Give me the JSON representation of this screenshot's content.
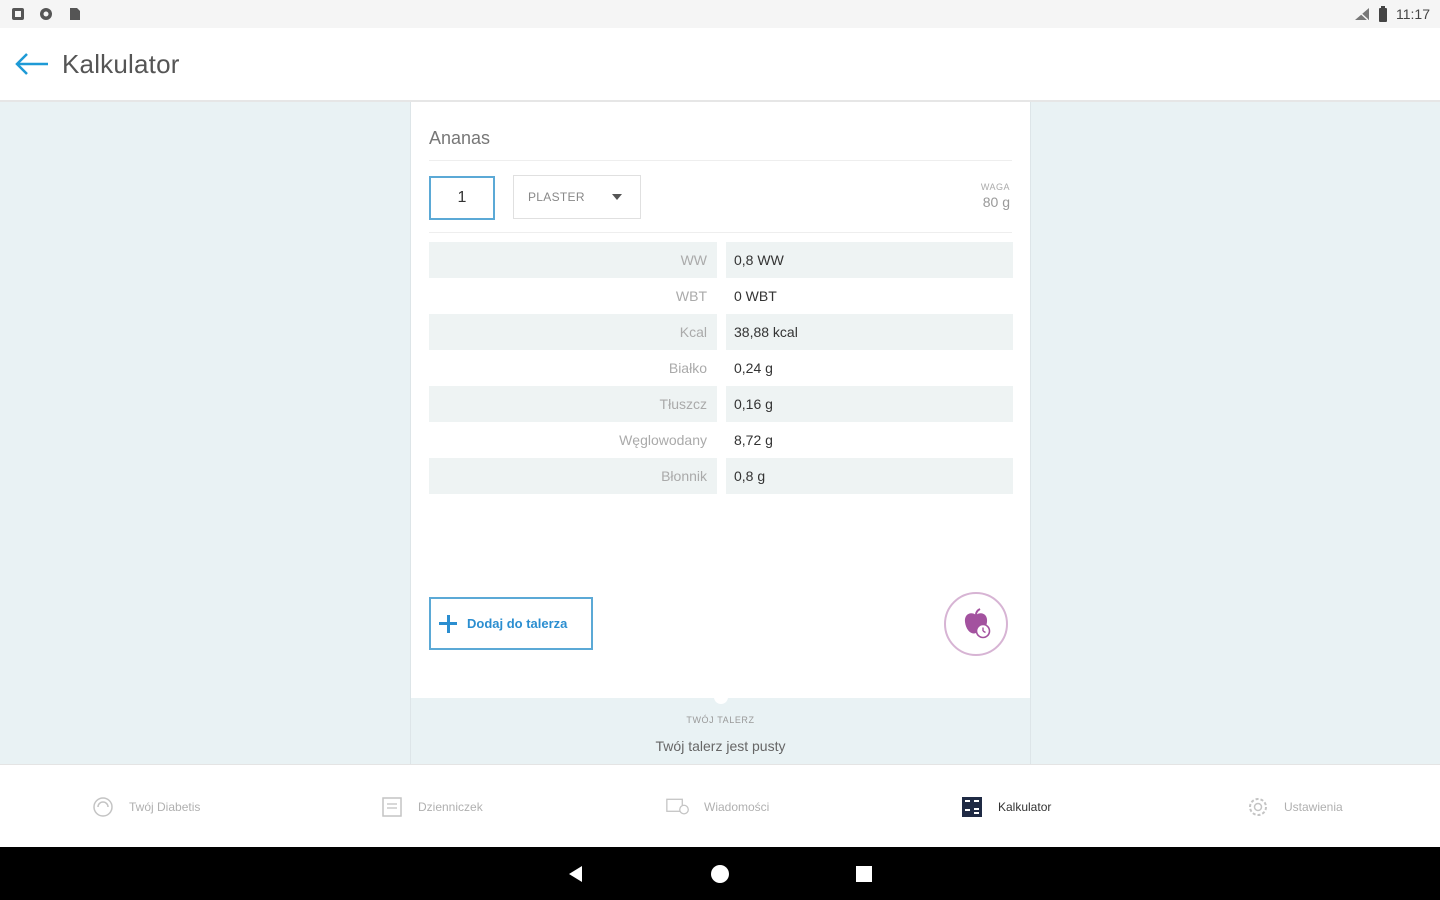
{
  "status_bar": {
    "time": "11:17"
  },
  "app_bar": {
    "title": "Kalkulator"
  },
  "product": {
    "name": "Ananas",
    "quantity": "1",
    "unit": "PLASTER",
    "weight_caption": "WAGA",
    "weight_value": "80 g"
  },
  "nutrition": [
    {
      "label": "WW",
      "value": "0,8 WW"
    },
    {
      "label": "WBT",
      "value": "0 WBT"
    },
    {
      "label": "Kcal",
      "value": "38,88 kcal"
    },
    {
      "label": "Białko",
      "value": "0,24 g"
    },
    {
      "label": "Tłuszcz",
      "value": "0,16 g"
    },
    {
      "label": "Węglowodany",
      "value": "8,72 g"
    },
    {
      "label": "Błonnik",
      "value": "0,8 g"
    }
  ],
  "actions": {
    "add_to_plate": "Dodaj do talerza"
  },
  "plate": {
    "caption": "TWÓJ TALERZ",
    "empty_text": "Twój talerz jest pusty"
  },
  "bottom_nav": [
    {
      "label": "Twój Diabetis",
      "icon": "diabetis-icon",
      "active": false
    },
    {
      "label": "Dzienniczek",
      "icon": "journal-icon",
      "active": false
    },
    {
      "label": "Wiadomości",
      "icon": "messages-icon",
      "active": false
    },
    {
      "label": "Kalkulator",
      "icon": "calculator-icon",
      "active": true
    },
    {
      "label": "Ustawienia",
      "icon": "settings-icon",
      "active": false
    }
  ],
  "colors": {
    "accent_blue": "#2b8ed0",
    "background_tint": "#e9f2f4",
    "row_shade": "#eef3f3",
    "fab_purple": "#9c4f9a"
  }
}
